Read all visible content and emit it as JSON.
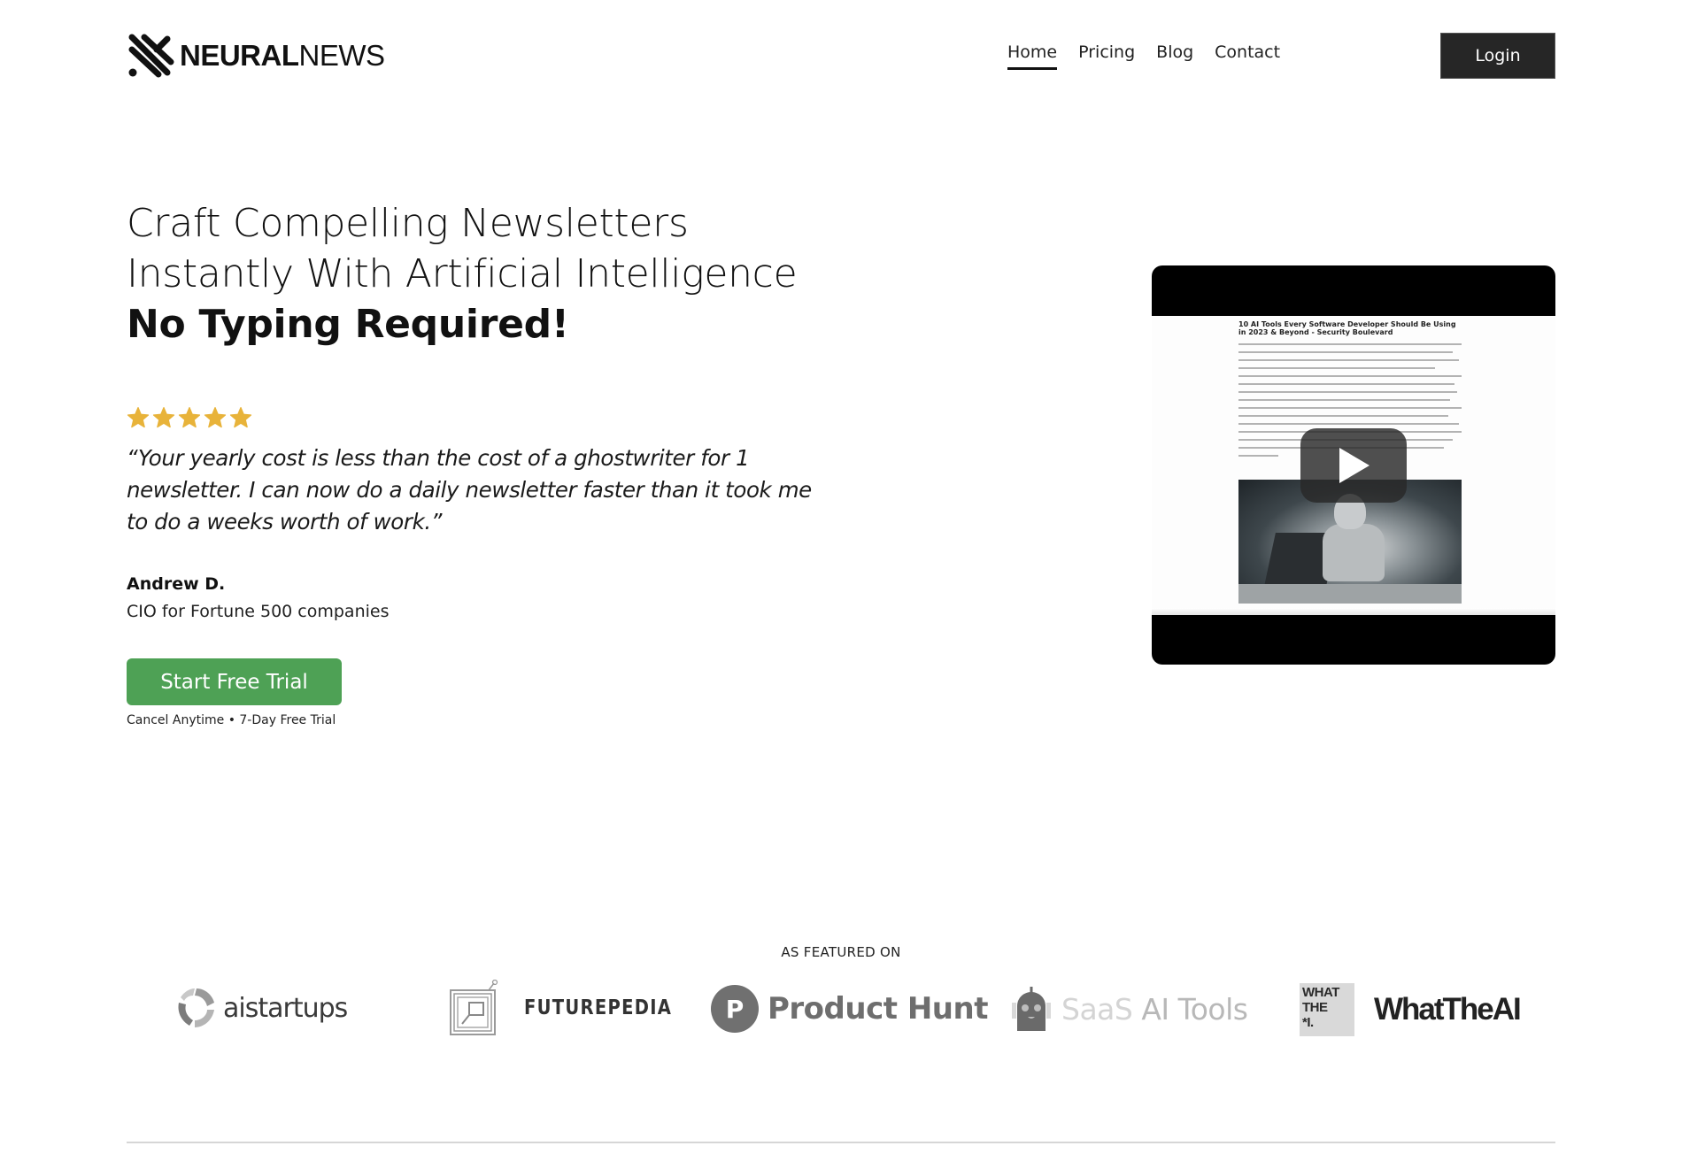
{
  "header": {
    "logo": {
      "bold": "NEURAL",
      "light": "NEWS",
      "icon": "neuralnews-logo-icon"
    },
    "nav": [
      {
        "label": "Home",
        "active": true
      },
      {
        "label": "Pricing",
        "active": false
      },
      {
        "label": "Blog",
        "active": false
      },
      {
        "label": "Contact",
        "active": false
      }
    ],
    "login_label": "Login"
  },
  "hero": {
    "headline_line1": "Craft Compelling Newsletters",
    "headline_line2": "Instantly With Artificial Intelligence",
    "headline_bold": "No Typing Required!",
    "rating": {
      "value": 5,
      "max": 5,
      "color": "#e8b33a"
    },
    "quote": "“Your yearly cost is less than the cost of a ghostwriter for 1 newsletter. I can now do a daily newsletter faster than it took me to do a weeks worth of work.”",
    "author_name": "Andrew D.",
    "author_title": "CIO for Fortune 500 companies",
    "cta_label": "Start Free Trial",
    "cta_color": "#4ea155",
    "cta_note": "Cancel Anytime • 7-Day Free Trial"
  },
  "video": {
    "article_title": "10 AI Tools Every Software Developer Should Be Using in 2023 & Beyond - Security Boulevard",
    "play_icon": "play-icon"
  },
  "featured": {
    "label": "AS FEATURED ON",
    "logos": [
      {
        "name": "aistartups",
        "text": "aistartups"
      },
      {
        "name": "futurepedia",
        "text": "FUTUREPEDIA"
      },
      {
        "name": "producthunt",
        "text": "Product Hunt",
        "badge": "P"
      },
      {
        "name": "saas-ai-tools",
        "text1": "SaaS",
        "text2": "AI Tools"
      },
      {
        "name": "whattheai",
        "text": "WhatTheAI",
        "box_line1": "WHAT",
        "box_line2": "THE",
        "box_line3": "*I."
      }
    ]
  }
}
